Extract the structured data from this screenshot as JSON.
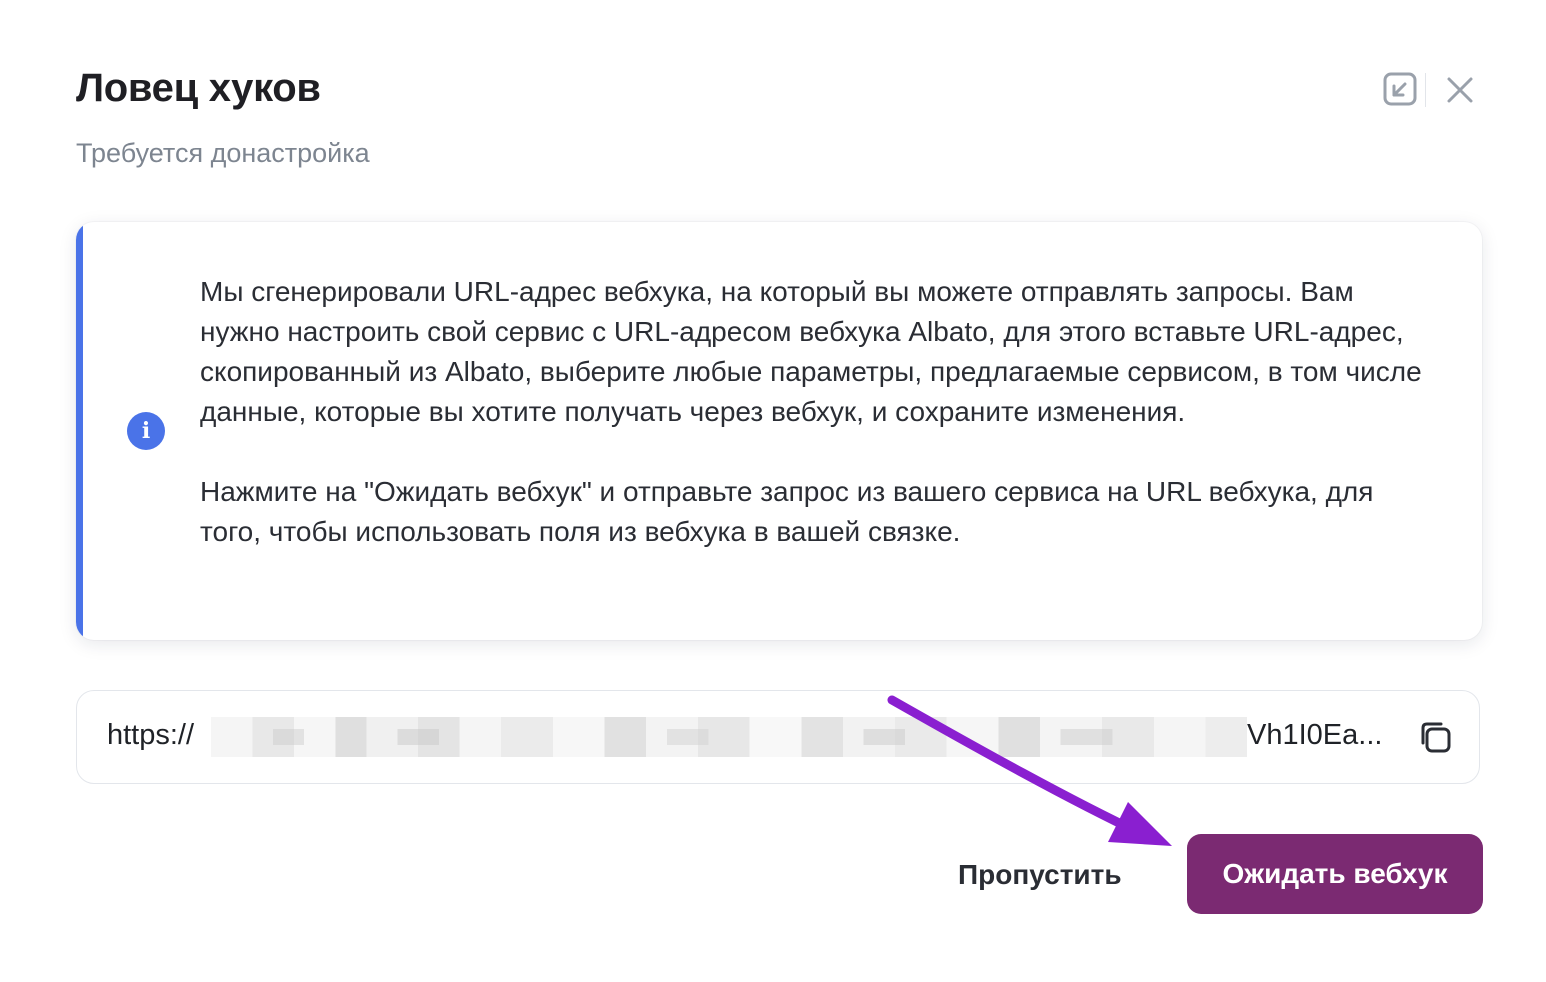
{
  "dialog": {
    "title": "Ловец хуков",
    "subtitle": "Требуется донастройка"
  },
  "header_actions": [
    {
      "icon": "collapse-icon"
    },
    {
      "icon": "close-icon"
    }
  ],
  "info": {
    "icon": "info-icon",
    "paragraph_1": "Мы сгенерировали URL-адрес вебхука, на который вы можете отправлять запросы. Вам нужно настроить свой сервис с URL-адресом вебхука Albato, для этого вставьте URL-адрес, скопированный из Albato, выберите любые параметры, предлагаемые сервисом, в том числе данные, которые вы хотите получать через вебхук, и сохраните изменения.",
    "paragraph_2": "Нажмите на \"Ожидать вебхук\" и отправьте запрос из вашего сервиса на URL вебхука, для того, чтобы использовать поля из вебхука в вашей связке."
  },
  "webhook_url": {
    "prefix": "https://",
    "suffix": "Vh1I0Ea...",
    "copy_icon": "copy-icon"
  },
  "buttons": {
    "skip": "Пропустить",
    "wait": "Ожидать вебхук"
  },
  "colors": {
    "accent_blue": "#4a73e8",
    "primary_button": "#7b2a72",
    "annotation_arrow": "#8a1fd0"
  }
}
